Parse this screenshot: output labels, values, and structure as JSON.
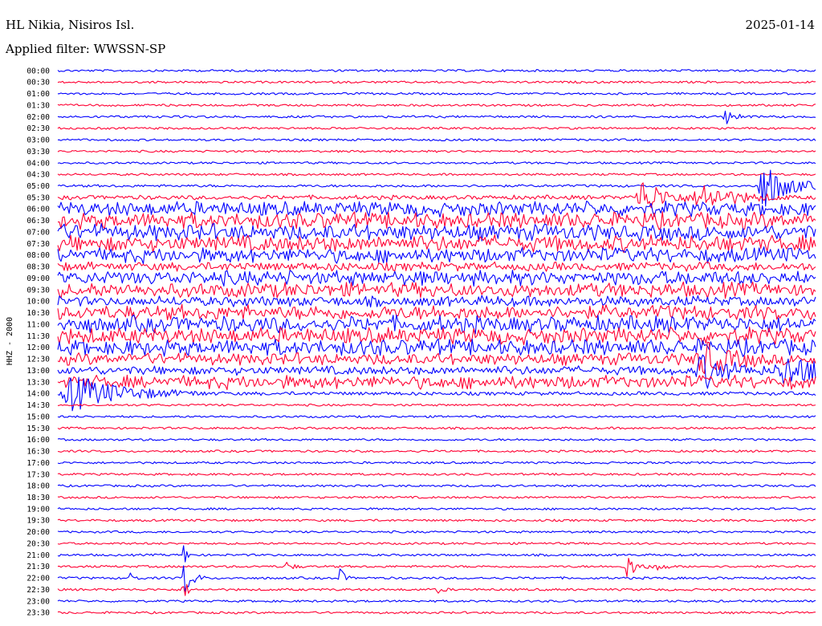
{
  "header": {
    "station": "HL Nikia, Nisiros Isl.",
    "date": "2025-01-14",
    "filter_text": "Applied filter: WWSSN-SP"
  },
  "chart_data": {
    "type": "line",
    "title": "HL Nikia, Nisiros Isl.",
    "subtitle": "Applied filter: WWSSN-SP",
    "date": "2025-01-14",
    "ylabel": "HHZ - 2000",
    "xlabel": "",
    "grid": false,
    "legend": "none",
    "series_colors": [
      "#0000ff",
      "#ff0033"
    ],
    "rows": [
      {
        "time": "00:00",
        "activity": 0.05,
        "events": []
      },
      {
        "time": "00:30",
        "activity": 0.05,
        "events": []
      },
      {
        "time": "01:00",
        "activity": 0.05,
        "events": []
      },
      {
        "time": "01:30",
        "activity": 0.05,
        "events": []
      },
      {
        "time": "02:00",
        "activity": 0.06,
        "events": [
          {
            "pos": 0.88,
            "amp": 0.8,
            "width": 0.012
          }
        ]
      },
      {
        "time": "02:30",
        "activity": 0.05,
        "events": []
      },
      {
        "time": "03:00",
        "activity": 0.05,
        "events": []
      },
      {
        "time": "03:30",
        "activity": 0.05,
        "events": []
      },
      {
        "time": "04:00",
        "activity": 0.05,
        "events": []
      },
      {
        "time": "04:30",
        "activity": 0.05,
        "events": []
      },
      {
        "time": "05:00",
        "activity": 0.08,
        "events": [
          {
            "pos": 0.93,
            "amp": 2.2,
            "width": 0.03
          }
        ]
      },
      {
        "time": "05:30",
        "activity": 0.2,
        "events": [
          {
            "pos": 0.77,
            "amp": 1.6,
            "width": 0.03
          },
          {
            "pos": 0.85,
            "amp": 1.2,
            "width": 0.04
          }
        ]
      },
      {
        "time": "06:00",
        "activity": 0.9,
        "events": []
      },
      {
        "time": "06:30",
        "activity": 1.0,
        "events": []
      },
      {
        "time": "07:00",
        "activity": 1.0,
        "events": []
      },
      {
        "time": "07:30",
        "activity": 1.0,
        "events": []
      },
      {
        "time": "08:00",
        "activity": 0.9,
        "events": []
      },
      {
        "time": "08:30",
        "activity": 0.5,
        "events": []
      },
      {
        "time": "09:00",
        "activity": 0.9,
        "events": []
      },
      {
        "time": "09:30",
        "activity": 0.9,
        "events": []
      },
      {
        "time": "10:00",
        "activity": 0.6,
        "events": []
      },
      {
        "time": "10:30",
        "activity": 0.9,
        "events": []
      },
      {
        "time": "11:00",
        "activity": 1.0,
        "events": []
      },
      {
        "time": "11:30",
        "activity": 1.0,
        "events": []
      },
      {
        "time": "12:00",
        "activity": 1.0,
        "events": []
      },
      {
        "time": "12:30",
        "activity": 0.7,
        "events": [
          {
            "pos": 0.85,
            "amp": 1.5,
            "width": 0.03
          }
        ]
      },
      {
        "time": "13:00",
        "activity": 0.5,
        "events": [
          {
            "pos": 0.85,
            "amp": 1.5,
            "width": 0.03
          },
          {
            "pos": 0.96,
            "amp": 1.3,
            "width": 0.05
          }
        ]
      },
      {
        "time": "13:30",
        "activity": 0.8,
        "events": []
      },
      {
        "time": "14:00",
        "activity": 0.15,
        "events": [
          {
            "pos": 0.02,
            "amp": 1.6,
            "width": 0.06
          }
        ]
      },
      {
        "time": "14:30",
        "activity": 0.05,
        "events": []
      },
      {
        "time": "15:00",
        "activity": 0.05,
        "events": []
      },
      {
        "time": "15:30",
        "activity": 0.05,
        "events": []
      },
      {
        "time": "16:00",
        "activity": 0.05,
        "events": []
      },
      {
        "time": "16:30",
        "activity": 0.05,
        "events": []
      },
      {
        "time": "17:00",
        "activity": 0.05,
        "events": []
      },
      {
        "time": "17:30",
        "activity": 0.05,
        "events": []
      },
      {
        "time": "18:00",
        "activity": 0.05,
        "events": []
      },
      {
        "time": "18:30",
        "activity": 0.05,
        "events": []
      },
      {
        "time": "19:00",
        "activity": 0.05,
        "events": []
      },
      {
        "time": "19:30",
        "activity": 0.05,
        "events": []
      },
      {
        "time": "20:00",
        "activity": 0.05,
        "events": []
      },
      {
        "time": "20:30",
        "activity": 0.05,
        "events": []
      },
      {
        "time": "21:00",
        "activity": 0.05,
        "events": [
          {
            "pos": 0.165,
            "amp": 1.4,
            "width": 0.004
          }
        ]
      },
      {
        "time": "21:30",
        "activity": 0.06,
        "events": [
          {
            "pos": 0.75,
            "amp": 1.2,
            "width": 0.012
          },
          {
            "pos": 0.79,
            "amp": 0.6,
            "width": 0.008
          },
          {
            "pos": 0.3,
            "amp": 0.5,
            "width": 0.008
          }
        ]
      },
      {
        "time": "22:00",
        "activity": 0.06,
        "events": [
          {
            "pos": 0.165,
            "amp": 1.8,
            "width": 0.01
          },
          {
            "pos": 0.37,
            "amp": 1.2,
            "width": 0.006
          },
          {
            "pos": 0.095,
            "amp": 0.5,
            "width": 0.006
          }
        ]
      },
      {
        "time": "22:30",
        "activity": 0.06,
        "events": [
          {
            "pos": 0.165,
            "amp": 1.2,
            "width": 0.005
          },
          {
            "pos": 0.5,
            "amp": 0.6,
            "width": 0.005
          }
        ]
      },
      {
        "time": "23:00",
        "activity": 0.05,
        "events": []
      },
      {
        "time": "23:30",
        "activity": 0.05,
        "events": []
      }
    ]
  }
}
